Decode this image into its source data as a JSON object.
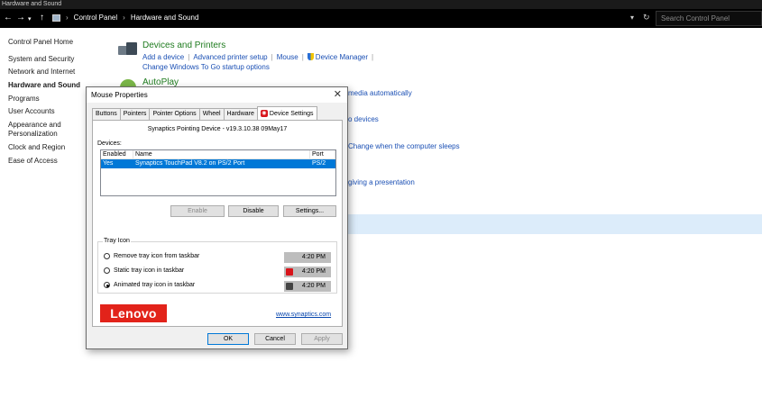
{
  "window": {
    "title": "Hardware and Sound"
  },
  "address": {
    "crumbs": [
      "Control Panel",
      "Hardware and Sound"
    ],
    "search_placeholder": "Search Control Panel"
  },
  "sidebar": {
    "items": [
      "Control Panel Home",
      "System and Security",
      "Network and Internet",
      "Hardware and Sound",
      "Programs",
      "User Accounts",
      "Appearance and Personalization",
      "Clock and Region",
      "Ease of Access"
    ]
  },
  "devices_printers": {
    "title": "Devices and Printers",
    "links": [
      "Add a device",
      "Advanced printer setup",
      "Mouse",
      "Device Manager"
    ],
    "link2": "Change Windows To Go startup options"
  },
  "autoplay": {
    "title": "AutoPlay"
  },
  "bg_links": {
    "media": "media automatically",
    "devices": "o devices",
    "sleep": "Change when the computer sleeps",
    "presentation": "giving a presentation"
  },
  "dialog": {
    "title": "Mouse Properties",
    "tabs": [
      "Buttons",
      "Pointers",
      "Pointer Options",
      "Wheel",
      "Hardware",
      "Device Settings"
    ],
    "device_name": "Synaptics Pointing Device - v19.3.10.38 09May17",
    "devices_label": "Devices:",
    "table_headers": [
      "Enabled",
      "Name",
      "Port"
    ],
    "table_rows": [
      {
        "enabled": "Yes",
        "name": "Synaptics TouchPad V8.2 on PS/2 Port",
        "port": "PS/2"
      }
    ],
    "buttons": {
      "enable": "Enable",
      "disable": "Disable",
      "settings": "Settings..."
    },
    "tray_icon": {
      "label": "Tray Icon",
      "options": [
        "Remove tray icon from taskbar",
        "Static tray icon in taskbar",
        "Animated tray icon in taskbar"
      ],
      "selected": 2,
      "preview_time": "4:20 PM"
    },
    "brand": "Lenovo",
    "link": "www.synaptics.com",
    "footer": {
      "ok": "OK",
      "cancel": "Cancel",
      "apply": "Apply"
    }
  },
  "colors": {
    "accent": "#0078d7",
    "lenovo": "#e2231a",
    "category_title": "#1e7b1e",
    "link": "#1a4fb4"
  }
}
